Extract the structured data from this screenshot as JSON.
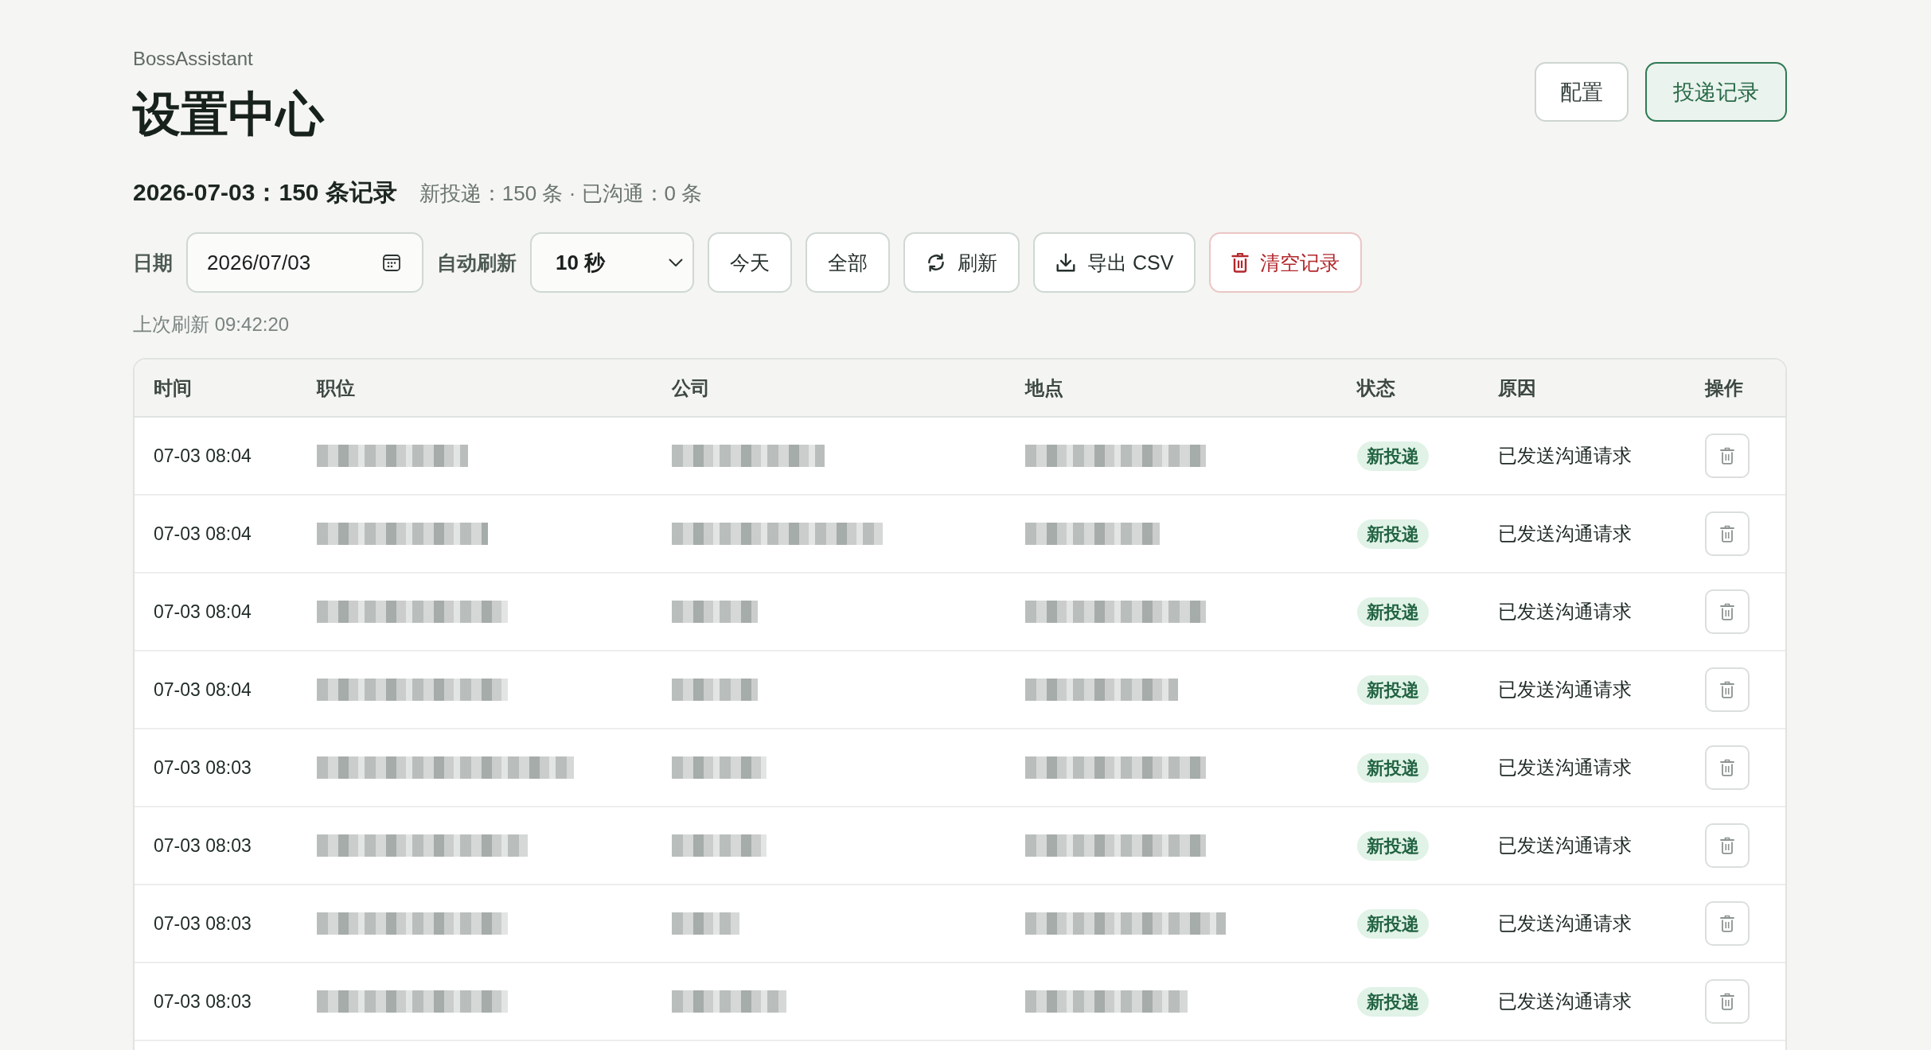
{
  "app_name": "BossAssistant",
  "title": "设置中心",
  "nav_buttons": [
    {
      "label": "配置",
      "selected": false
    },
    {
      "label": "投递记录",
      "selected": true
    }
  ],
  "summary": {
    "headline": "2026-07-03：150 条记录",
    "detail": "新投递：150 条 · 已沟通：0 条"
  },
  "toolbar": {
    "date_label": "日期",
    "date_value": "2026/07/03",
    "refresh_label": "自动刷新",
    "refresh_interval": "10 秒",
    "buttons": [
      {
        "label": "今天",
        "kind": "plain"
      },
      {
        "label": "全部",
        "kind": "plain"
      },
      {
        "label": "刷新",
        "kind": "refresh"
      },
      {
        "label": "导出 CSV",
        "kind": "export"
      },
      {
        "label": "清空记录",
        "kind": "danger"
      }
    ]
  },
  "last_refresh": "上次刷新 09:42:20",
  "table": {
    "columns": [
      "时间",
      "职位",
      "公司",
      "地点",
      "状态",
      "原因",
      "操作"
    ],
    "rows": [
      {
        "time": "07-03 08:04",
        "status": "新投递",
        "reason": "已发送沟通请求"
      },
      {
        "time": "07-03 08:04",
        "status": "新投递",
        "reason": "已发送沟通请求"
      },
      {
        "time": "07-03 08:04",
        "status": "新投递",
        "reason": "已发送沟通请求"
      },
      {
        "time": "07-03 08:04",
        "status": "新投递",
        "reason": "已发送沟通请求"
      },
      {
        "time": "07-03 08:03",
        "status": "新投递",
        "reason": "已发送沟通请求"
      },
      {
        "time": "07-03 08:03",
        "status": "新投递",
        "reason": "已发送沟通请求"
      },
      {
        "time": "07-03 08:03",
        "status": "新投递",
        "reason": "已发送沟通请求"
      },
      {
        "time": "07-03 08:03",
        "status": "新投递",
        "reason": "已发送沟通请求"
      }
    ]
  }
}
